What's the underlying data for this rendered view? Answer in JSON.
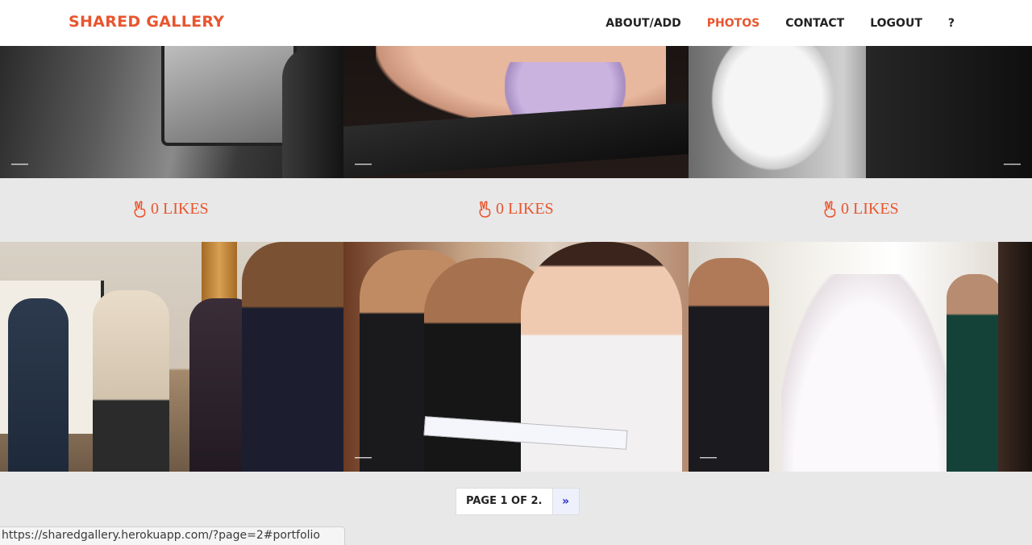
{
  "navbar": {
    "brand": "SHARED GALLERY",
    "links": [
      {
        "label": "ABOUT/ADD",
        "active": false
      },
      {
        "label": "PHOTOS",
        "active": true
      },
      {
        "label": "CONTACT",
        "active": false
      },
      {
        "label": "LOGOUT",
        "active": false
      },
      {
        "label": "?",
        "active": false
      }
    ]
  },
  "gallery": {
    "likes": [
      {
        "label": "0 LIKES",
        "icon": "hand-peace-icon"
      },
      {
        "label": "0 LIKES",
        "icon": "hand-peace-icon"
      },
      {
        "label": "0 LIKES",
        "icon": "hand-peace-icon"
      }
    ]
  },
  "pagination": {
    "info": "PAGE 1 OF 2.",
    "next": "»"
  },
  "status_bar": {
    "url": "https://sharedgallery.herokuapp.com/?page=2#portfolio"
  },
  "colors": {
    "accent": "#e8552f",
    "background": "#e8e8e8",
    "link_blue": "#2a2acb"
  }
}
